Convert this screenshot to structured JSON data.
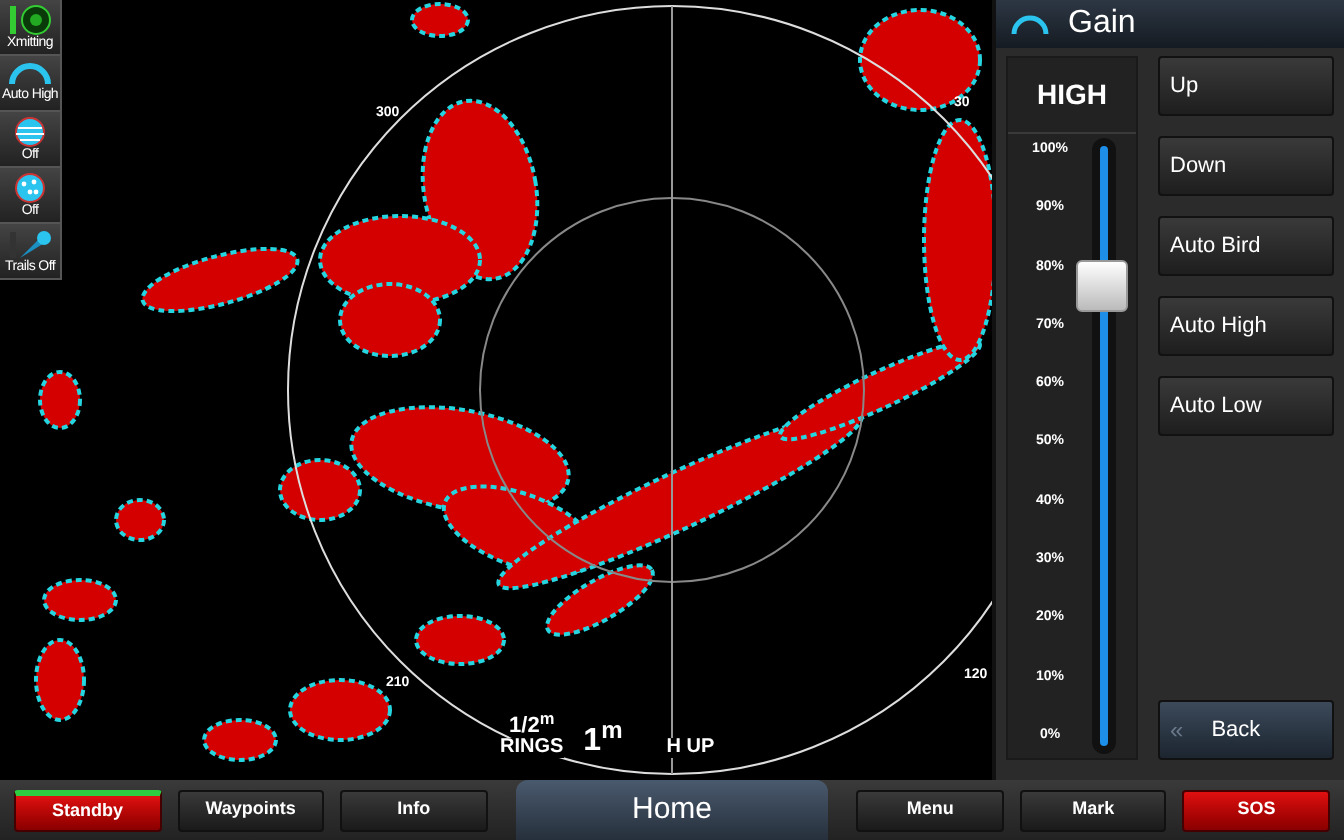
{
  "left_toolbar": [
    {
      "label": "Xmitting",
      "kind": "radar"
    },
    {
      "label": "Auto High",
      "kind": "gauge"
    },
    {
      "label": "Off",
      "kind": "globe"
    },
    {
      "label": "Off",
      "kind": "dots"
    },
    {
      "label": "Trails Off",
      "kind": "trails"
    }
  ],
  "radar": {
    "bearings": [
      "300",
      "30",
      "210",
      "120"
    ],
    "rings": "1/2$^{m}$",
    "rings_label": "RINGS",
    "range": "1$^{m}$",
    "orientation": "H UP"
  },
  "gain_panel": {
    "title": "Gain",
    "mode": "HIGH",
    "slider": {
      "level": 0.76,
      "ticks": [
        "100%",
        "90%",
        "80%",
        "70%",
        "60%",
        "50%",
        "40%",
        "30%",
        "20%",
        "10%",
        "0%"
      ]
    },
    "buttons": [
      "Up",
      "Down",
      "Auto Bird",
      "Auto High",
      "Auto Low"
    ],
    "back_icon": "«",
    "back": "Back"
  },
  "bottom_bar": [
    {
      "label": "Standby",
      "kind": "alert",
      "active": true
    },
    {
      "label": "Waypoints",
      "kind": "normal",
      "active": false
    },
    {
      "label": "Info",
      "kind": "normal",
      "active": false
    },
    {
      "label": "Home",
      "kind": "home",
      "active": false
    },
    {
      "label": "Menu",
      "kind": "normal",
      "active": false
    },
    {
      "label": "Mark",
      "kind": "normal",
      "active": false
    },
    {
      "label": "SOS",
      "kind": "alert",
      "active": false
    }
  ]
}
